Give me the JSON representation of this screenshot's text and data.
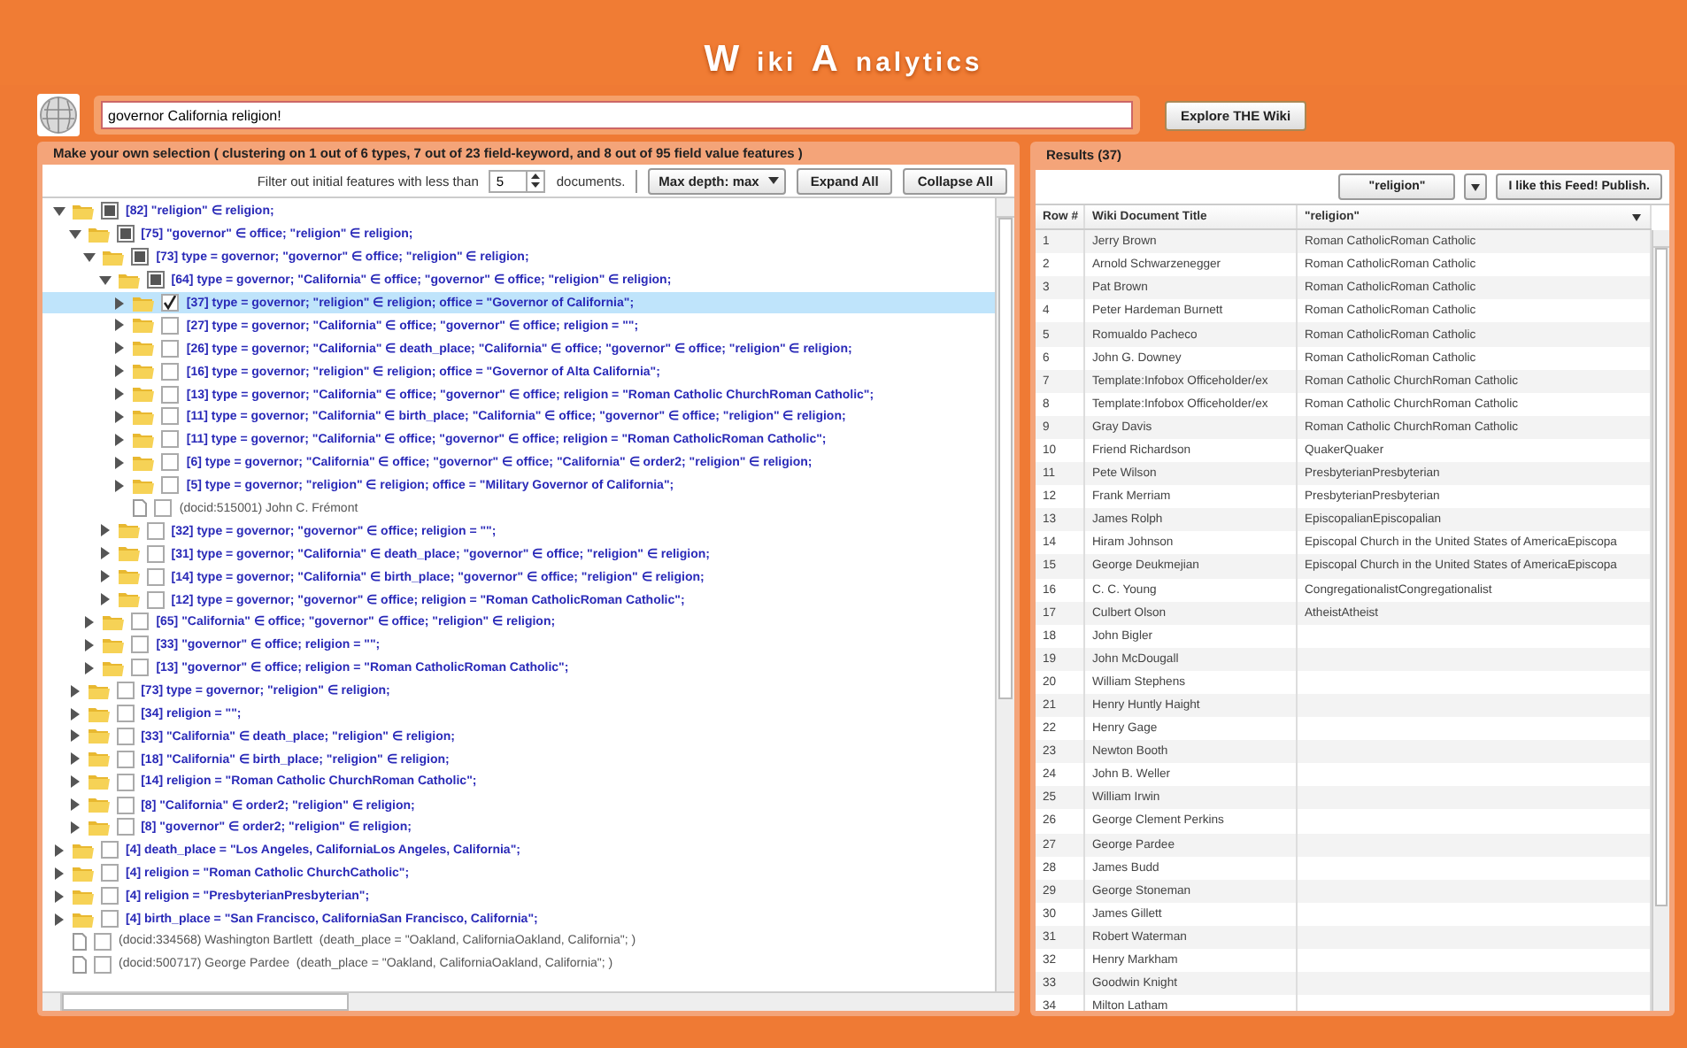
{
  "title_parts": [
    {
      "text": "W",
      "kind": "initial"
    },
    {
      "text": "iki",
      "kind": "rest"
    },
    {
      "text": "A",
      "kind": "initial"
    },
    {
      "text": "nalytics",
      "kind": "rest"
    }
  ],
  "search": {
    "value": "governor California religion!",
    "button": "Explore THE Wiki"
  },
  "selection_panel": {
    "title": "Make your own selection ( clustering on 1 out of 6 types, 7 out of 23 field-keyword, and 8 out of 95 field value features )",
    "filter_label": "Filter out initial features with less than",
    "min_docs": "5",
    "filter_suffix": "documents.",
    "depth_select": "Max depth: max",
    "buttons": [
      "Expand All",
      "Collapse All"
    ],
    "tree": [
      {
        "kind": "group",
        "label": "[82] \"religion\" ∈ religion;",
        "expanded": true,
        "checked": false,
        "partial": true,
        "selected": false,
        "children": [
          {
            "kind": "group",
            "label": "[75] \"governor\" ∈ office; \"religion\" ∈ religion;",
            "expanded": true,
            "checked": false,
            "partial": true,
            "selected": false,
            "children": [
              {
                "kind": "group",
                "label": "[73] type = governor; \"governor\" ∈ office; \"religion\" ∈ religion;",
                "expanded": true,
                "checked": false,
                "partial": true,
                "selected": false,
                "children": [
                  {
                    "kind": "group",
                    "label": "[64] type = governor; \"California\" ∈ office; \"governor\" ∈ office; \"religion\" ∈ religion;",
                    "expanded": true,
                    "checked": false,
                    "partial": true,
                    "selected": false,
                    "children": [
                      {
                        "kind": "group",
                        "label": "[37] type = governor; \"religion\" ∈ religion; office = \"Governor of California\";",
                        "expanded": false,
                        "checked": true,
                        "partial": false,
                        "selected": true
                      },
                      {
                        "kind": "group",
                        "label": "[27] type = governor; \"California\" ∈ office; \"governor\" ∈ office; religion = \"\";",
                        "expanded": false,
                        "checked": false,
                        "partial": false,
                        "selected": false
                      },
                      {
                        "kind": "group",
                        "label": "[26] type = governor; \"California\" ∈ death_place; \"California\" ∈ office; \"governor\" ∈ office; \"religion\" ∈ religion;",
                        "expanded": false,
                        "checked": false,
                        "partial": false,
                        "selected": false
                      },
                      {
                        "kind": "group",
                        "label": "[16] type = governor; \"religion\" ∈ religion; office = \"Governor of Alta California\";",
                        "expanded": false,
                        "checked": false,
                        "partial": false,
                        "selected": false
                      },
                      {
                        "kind": "group",
                        "label": "[13] type = governor; \"California\" ∈ office; \"governor\" ∈ office; religion = \"Roman Catholic ChurchRoman Catholic\";",
                        "expanded": false,
                        "checked": false,
                        "partial": false,
                        "selected": false
                      },
                      {
                        "kind": "group",
                        "label": "[11] type = governor; \"California\" ∈ birth_place; \"California\" ∈ office; \"governor\" ∈ office; \"religion\" ∈ religion;",
                        "expanded": false,
                        "checked": false,
                        "partial": false,
                        "selected": false
                      },
                      {
                        "kind": "group",
                        "label": "[11] type = governor; \"California\" ∈ office; \"governor\" ∈ office; religion = \"Roman CatholicRoman Catholic\";",
                        "expanded": false,
                        "checked": false,
                        "partial": false,
                        "selected": false
                      },
                      {
                        "kind": "group",
                        "label": "[6] type = governor; \"California\" ∈ office; \"governor\" ∈ office; \"California\" ∈ order2; \"religion\" ∈ religion;",
                        "expanded": false,
                        "checked": false,
                        "partial": false,
                        "selected": false
                      },
                      {
                        "kind": "group",
                        "label": "[5] type = governor; \"religion\" ∈ religion; office = \"Military Governor of California\";",
                        "expanded": false,
                        "checked": false,
                        "partial": false,
                        "selected": false
                      },
                      {
                        "kind": "doc",
                        "label": "(docid:515001) John C. Frémont",
                        "checked": false,
                        "partial": false,
                        "selected": false
                      }
                    ]
                  },
                  {
                    "kind": "group",
                    "label": "[32] type = governor; \"governor\" ∈ office; religion = \"\";",
                    "expanded": false,
                    "checked": false,
                    "partial": false,
                    "selected": false
                  },
                  {
                    "kind": "group",
                    "label": "[31] type = governor; \"California\" ∈ death_place; \"governor\" ∈ office; \"religion\" ∈ religion;",
                    "expanded": false,
                    "checked": false,
                    "partial": false,
                    "selected": false
                  },
                  {
                    "kind": "group",
                    "label": "[14] type = governor; \"California\" ∈ birth_place; \"governor\" ∈ office; \"religion\" ∈ religion;",
                    "expanded": false,
                    "checked": false,
                    "partial": false,
                    "selected": false
                  },
                  {
                    "kind": "group",
                    "label": "[12] type = governor; \"governor\" ∈ office; religion = \"Roman CatholicRoman Catholic\";",
                    "expanded": false,
                    "checked": false,
                    "partial": false,
                    "selected": false
                  }
                ]
              },
              {
                "kind": "group",
                "label": "[65] \"California\" ∈ office; \"governor\" ∈ office; \"religion\" ∈ religion;",
                "expanded": false,
                "checked": false,
                "partial": false,
                "selected": false
              },
              {
                "kind": "group",
                "label": "[33] \"governor\" ∈ office; religion = \"\";",
                "expanded": false,
                "checked": false,
                "partial": false,
                "selected": false
              },
              {
                "kind": "group",
                "label": "[13] \"governor\" ∈ office; religion = \"Roman CatholicRoman Catholic\";",
                "expanded": false,
                "checked": false,
                "partial": false,
                "selected": false
              }
            ]
          },
          {
            "kind": "group",
            "label": "[73] type = governor; \"religion\" ∈ religion;",
            "expanded": false,
            "checked": false,
            "partial": false,
            "selected": false
          },
          {
            "kind": "group",
            "label": "[34] religion = \"\";",
            "expanded": false,
            "checked": false,
            "partial": false,
            "selected": false
          },
          {
            "kind": "group",
            "label": "[33] \"California\" ∈ death_place; \"religion\" ∈ religion;",
            "expanded": false,
            "checked": false,
            "partial": false,
            "selected": false
          },
          {
            "kind": "group",
            "label": "[18] \"California\" ∈ birth_place; \"religion\" ∈ religion;",
            "expanded": false,
            "checked": false,
            "partial": false,
            "selected": false
          },
          {
            "kind": "group",
            "label": "[14] religion = \"Roman Catholic ChurchRoman Catholic\";",
            "expanded": false,
            "checked": false,
            "partial": false,
            "selected": false
          },
          {
            "kind": "group",
            "label": "[8] \"California\" ∈ order2; \"religion\" ∈ religion;",
            "expanded": false,
            "checked": false,
            "partial": false,
            "selected": false
          },
          {
            "kind": "group",
            "label": "[8] \"governor\" ∈ order2; \"religion\" ∈ religion;",
            "expanded": false,
            "checked": false,
            "partial": false,
            "selected": false
          }
        ]
      },
      {
        "kind": "group",
        "label": "[4] death_place = \"Los Angeles, CaliforniaLos Angeles, California\";",
        "expanded": false,
        "checked": false,
        "partial": false,
        "selected": false
      },
      {
        "kind": "group",
        "label": "[4] religion = \"Roman Catholic ChurchCatholic\";",
        "expanded": false,
        "checked": false,
        "partial": false,
        "selected": false
      },
      {
        "kind": "group",
        "label": "[4] religion = \"PresbyterianPresbyterian\";",
        "expanded": false,
        "checked": false,
        "partial": false,
        "selected": false
      },
      {
        "kind": "group",
        "label": "[4] birth_place = \"San Francisco, CaliforniaSan Francisco, California\";",
        "expanded": false,
        "checked": false,
        "partial": false,
        "selected": false
      },
      {
        "kind": "doc",
        "label": "(docid:334568) Washington Bartlett  (death_place = \"Oakland, CaliforniaOakland, California\"; )",
        "checked": false,
        "partial": false,
        "selected": false
      },
      {
        "kind": "doc",
        "label": "(docid:500717) George Pardee  (death_place = \"Oakland, CaliforniaOakland, California\"; )",
        "checked": false,
        "partial": false,
        "selected": false
      }
    ]
  },
  "results": {
    "title": "Results (37)",
    "field_select": "\"religion\"",
    "publish_button": "I like this Feed! Publish.",
    "columns": [
      "Row #",
      "Wiki Document Title",
      "\"religion\""
    ],
    "rows": [
      [
        "1",
        "Jerry Brown",
        "Roman CatholicRoman Catholic"
      ],
      [
        "2",
        "Arnold Schwarzenegger",
        "Roman CatholicRoman Catholic"
      ],
      [
        "3",
        "Pat Brown",
        "Roman CatholicRoman Catholic"
      ],
      [
        "4",
        "Peter Hardeman Burnett",
        "Roman CatholicRoman Catholic"
      ],
      [
        "5",
        "Romualdo Pacheco",
        "Roman CatholicRoman Catholic"
      ],
      [
        "6",
        "John G. Downey",
        "Roman CatholicRoman Catholic"
      ],
      [
        "7",
        "Template:Infobox Officeholder/ex",
        "Roman Catholic ChurchRoman Catholic"
      ],
      [
        "8",
        "Template:Infobox Officeholder/ex",
        "Roman Catholic ChurchRoman Catholic"
      ],
      [
        "9",
        "Gray Davis",
        "Roman Catholic ChurchRoman Catholic"
      ],
      [
        "10",
        "Friend Richardson",
        "QuakerQuaker"
      ],
      [
        "11",
        "Pete Wilson",
        "PresbyterianPresbyterian"
      ],
      [
        "12",
        "Frank Merriam",
        "PresbyterianPresbyterian"
      ],
      [
        "13",
        "James Rolph",
        "EpiscopalianEpiscopalian"
      ],
      [
        "14",
        "Hiram Johnson",
        "Episcopal Church in the United States of AmericaEpiscopa"
      ],
      [
        "15",
        "George Deukmejian",
        "Episcopal Church in the United States of AmericaEpiscopa"
      ],
      [
        "16",
        "C. C. Young",
        "CongregationalistCongregationalist"
      ],
      [
        "17",
        "Culbert Olson",
        "AtheistAtheist"
      ],
      [
        "18",
        "John Bigler"
      ],
      [
        "19",
        "John McDougall"
      ],
      [
        "20",
        "William Stephens"
      ],
      [
        "21",
        "Henry Huntly Haight"
      ],
      [
        "22",
        "Henry Gage"
      ],
      [
        "23",
        "Newton Booth"
      ],
      [
        "24",
        "John B. Weller"
      ],
      [
        "25",
        "William Irwin"
      ],
      [
        "26",
        "George Clement Perkins"
      ],
      [
        "27",
        "George Pardee"
      ],
      [
        "28",
        "James Budd"
      ],
      [
        "29",
        "George Stoneman"
      ],
      [
        "30",
        "James Gillett"
      ],
      [
        "31",
        "Robert Waterman"
      ],
      [
        "32",
        "Henry Markham"
      ],
      [
        "33",
        "Goodwin Knight"
      ],
      [
        "34",
        "Milton Latham"
      ]
    ]
  }
}
